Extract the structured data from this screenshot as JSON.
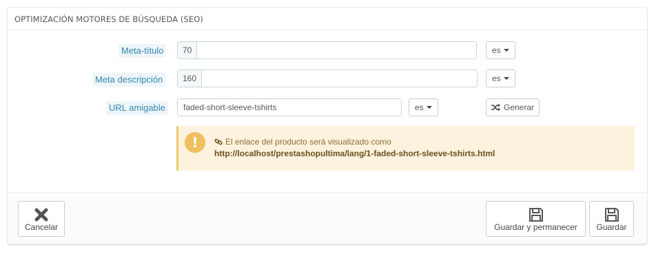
{
  "panel": {
    "heading": "OPTIMIZACIÓN MOTORES DE BÚSQUEDA (SEO)"
  },
  "fields": {
    "meta_title": {
      "label": "Meta-título",
      "counter": "70",
      "value": "",
      "lang": "es"
    },
    "meta_description": {
      "label": "Meta descripción",
      "counter": "160",
      "value": "",
      "lang": "es"
    },
    "friendly_url": {
      "label": "URL amigable",
      "value": "faded-short-sleeve-tshirts",
      "lang": "es",
      "generate_label": "Generar"
    }
  },
  "alert": {
    "message": "El enlace del producto será visualizado como",
    "url": "http://localhost/prestashopultima/lang/1-faded-short-sleeve-tshirts.html"
  },
  "footer": {
    "cancel_label": "Cancelar",
    "save_stay_label": "Guardar y permanecer",
    "save_label": "Guardar"
  },
  "icons": {
    "warning": "exclamation-circle-icon",
    "link": "link-icon",
    "random": "shuffle-icon",
    "cancel": "close-icon",
    "save": "floppy-disk-icon"
  },
  "colors": {
    "label_text": "#3586ae",
    "label_bg": "#eef6fa",
    "alert_bg": "#fcf2dd",
    "alert_icon": "#efbf61"
  }
}
